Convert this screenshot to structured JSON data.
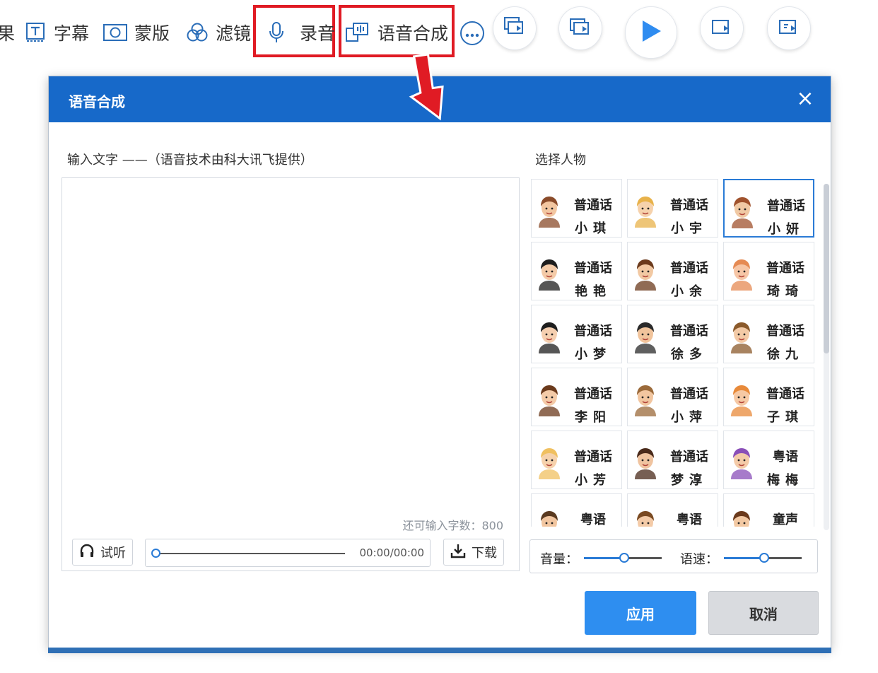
{
  "toolbar": {
    "edge_fragment": "果",
    "items": [
      {
        "label": "字幕",
        "icon": "subtitle-icon"
      },
      {
        "label": "蒙版",
        "icon": "mask-icon"
      },
      {
        "label": "滤镜",
        "icon": "filter-icon"
      },
      {
        "label": "录音",
        "icon": "microphone-icon"
      },
      {
        "label": "语音合成",
        "icon": "speech-synthesis-icon"
      }
    ],
    "more_icon": "more-icon",
    "highlight_color": "#e01b24"
  },
  "dialog": {
    "title": "语音合成",
    "close_symbol": "×",
    "header_color": "#1769c9",
    "input_label": "输入文字 ——（语音技术由科大讯飞提供）",
    "input_value": "",
    "remaining_label": "还可输入字数：",
    "remaining_count": "800",
    "preview_button": "试听",
    "download_button": "下载",
    "player_time": "00:00/00:00",
    "player_progress": 0,
    "select_label": "选择人物",
    "voices": [
      {
        "dialect": "普通话",
        "name": "小琪",
        "selected": false
      },
      {
        "dialect": "普通话",
        "name": "小宇",
        "selected": false
      },
      {
        "dialect": "普通话",
        "name": "小妍",
        "selected": true
      },
      {
        "dialect": "普通话",
        "name": "艳艳",
        "selected": false
      },
      {
        "dialect": "普通话",
        "name": "小余",
        "selected": false
      },
      {
        "dialect": "普通话",
        "name": "琦琦",
        "selected": false
      },
      {
        "dialect": "普通话",
        "name": "小梦",
        "selected": false
      },
      {
        "dialect": "普通话",
        "name": "徐多",
        "selected": false
      },
      {
        "dialect": "普通话",
        "name": "徐九",
        "selected": false
      },
      {
        "dialect": "普通话",
        "name": "李阳",
        "selected": false
      },
      {
        "dialect": "普通话",
        "name": "小萍",
        "selected": false
      },
      {
        "dialect": "普通话",
        "name": "子琪",
        "selected": false
      },
      {
        "dialect": "普通话",
        "name": "小芳",
        "selected": false
      },
      {
        "dialect": "普通话",
        "name": "梦淳",
        "selected": false
      },
      {
        "dialect": "粤语",
        "name": "梅梅",
        "selected": false
      },
      {
        "dialect": "粤语",
        "name": "",
        "selected": false
      },
      {
        "dialect": "粤语",
        "name": "",
        "selected": false
      },
      {
        "dialect": "童声",
        "name": "",
        "selected": false
      }
    ],
    "volume_label": "音量：",
    "volume_level": 0.52,
    "speed_label": "语速：",
    "speed_level": 0.52,
    "apply_button": "应用",
    "cancel_button": "取消",
    "accent_color": "#2e8ef0"
  }
}
